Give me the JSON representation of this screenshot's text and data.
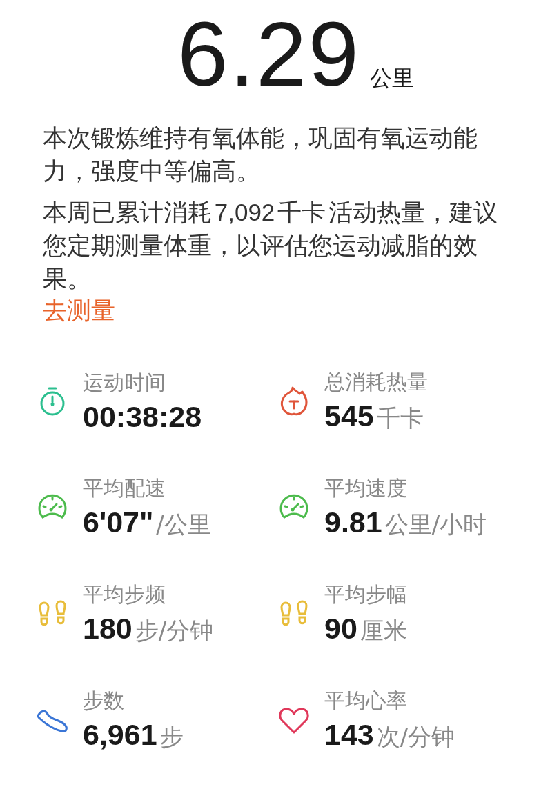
{
  "distance": {
    "value": "6.29",
    "unit": "公里"
  },
  "summary": [
    "本次锻炼维持有氧体能，巩固有氧运动能力，强度中等偏高。",
    "本周已累计消耗 7,092 千卡 活动热量，建议您定期测量体重，以评估您运动减脂的效果。"
  ],
  "link": "去测量",
  "stats": [
    {
      "kind": "stopwatch",
      "color": "#2cbf8f",
      "label": "运动时间",
      "value": "00:38:28"
    },
    {
      "kind": "flame",
      "color": "#e0553a",
      "label": "总消耗热量",
      "value": "545",
      "unit": "千卡"
    },
    {
      "kind": "gauge",
      "color": "#4cbb4c",
      "label": "平均配速",
      "value": "6'07\"",
      "unit": "/公里"
    },
    {
      "kind": "gauge",
      "color": "#4cbb4c",
      "label": "平均速度",
      "value": "9.81",
      "unit": "公里/小时"
    },
    {
      "kind": "footprints",
      "color": "#e8bd3a",
      "label": "平均步频",
      "value": "180",
      "unit": "步/分钟"
    },
    {
      "kind": "footprints",
      "color": "#e8bd3a",
      "label": "平均步幅",
      "value": "90",
      "unit": "厘米"
    },
    {
      "kind": "shoe",
      "color": "#3b76d6",
      "label": "步数",
      "value": "6,961",
      "unit": "步"
    },
    {
      "kind": "heart",
      "color": "#e0385a",
      "label": "平均心率",
      "value": "143",
      "unit": "次/分钟"
    }
  ]
}
